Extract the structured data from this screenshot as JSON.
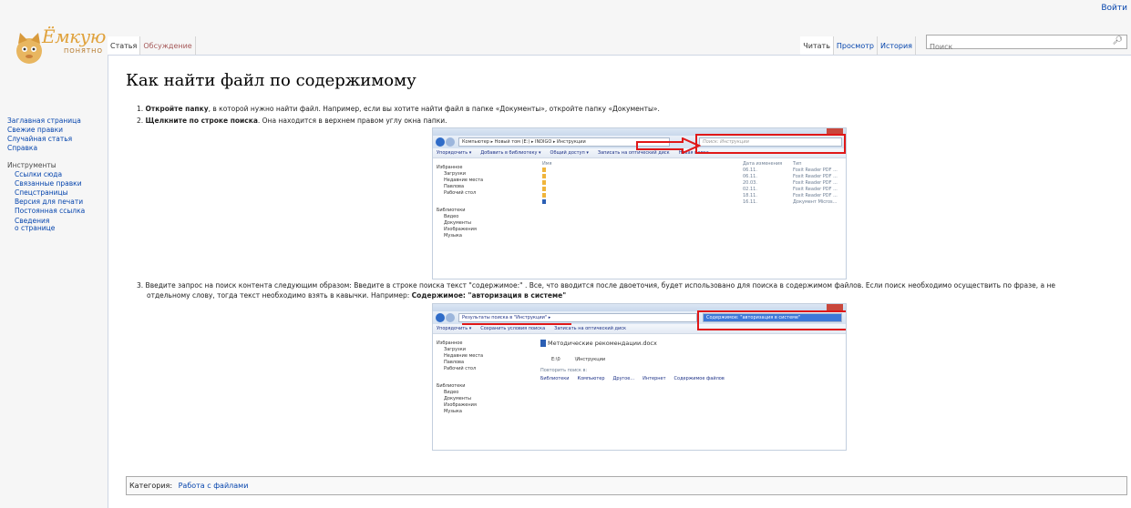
{
  "header": {
    "login": "Войти"
  },
  "logo": {
    "text": "Ёмкую",
    "sub": "ПОНЯТНО",
    "accent": "#e0a23c"
  },
  "tabs_left": [
    "Статья",
    "Обсуждение"
  ],
  "tabs_right": [
    "Читать",
    "Просмотр",
    "История"
  ],
  "search": {
    "placeholder": "Поиск"
  },
  "sidebar": {
    "nav": [
      "Заглавная страница",
      "Свежие правки",
      "Случайная статья",
      "Справка"
    ],
    "tools_heading": "Инструменты",
    "tools": [
      "Ссылки сюда",
      "Связанные правки",
      "Спецстраницы",
      "Версия для печати",
      "Постоянная ссылка",
      "Сведения",
      "о странице"
    ]
  },
  "article": {
    "title": "Как найти файл по содержимому",
    "step1": {
      "num": "1.",
      "bold": "Откройте папку",
      "text": ", в которой нужно найти файл. Например, если вы хотите найти файл в папке «Документы», откройте папку «Документы»."
    },
    "step2": {
      "num": "2.",
      "bold": "Щелкните по строке поиска",
      "text": ". Она находится в верхнем правом углу окна папки."
    },
    "step3": {
      "num": "3.",
      "line1": "Введите запрос на поиск контента следующим образом: Введите в строке поиска текст \"содержимое:\" . Все, что вводится после двоеточия, будет использовано для поиска в содержимом файлов. Если поиск необходимо осуществить по фразе, а не",
      "line2": "отдельному слову, тогда текст необходимо взять в кавычки. Например: ",
      "bold": "Содержимое: \"авторизация в системе\""
    }
  },
  "shot1": {
    "path": "Компьютер ▸ Новый том (E:) ▸ INDIGO ▸ Инструкции",
    "search": "Поиск: Инструкции",
    "tools": [
      "Упорядочить ▾",
      "Добавить в библиотеку ▾",
      "Общий доступ ▾",
      "Записать на оптический диск",
      "Новая папка"
    ],
    "nav": [
      "Избранное",
      "Загрузки",
      "Недавние места",
      "Павлова",
      "Рабочий стол",
      "Библиотеки",
      "Видео",
      "Документы",
      "Изображения",
      "Музыка"
    ],
    "columns": [
      "Имя",
      "Дата изменения",
      "Тип"
    ],
    "dates": [
      "06.11.",
      "06.11.",
      "20.03.",
      "02.11.",
      "18.11.",
      "16.11."
    ],
    "types": [
      "Foxit Reader PDF ...",
      "Foxit Reader PDF ...",
      "Foxit Reader PDF ...",
      "Foxit Reader PDF ...",
      "Foxit Reader PDF ...",
      "Документ Micros..."
    ]
  },
  "shot2": {
    "path": "Результаты поиска в \"Инструкции\" ▸",
    "search": "Содержимое: \"авторизация в системе\"",
    "tools": [
      "Упорядочить ▾",
      "Сохранить условия поиска",
      "Записать на оптический диск"
    ],
    "nav": [
      "Избранное",
      "Загрузки",
      "Недавние места",
      "Павлова",
      "Рабочий стол",
      "Библиотеки",
      "Видео",
      "Документы",
      "Изображения",
      "Музыка"
    ],
    "file": "Методические рекомендации.docx",
    "drive": "E:\\0",
    "folder": "\\Инструкции",
    "repeat": "Повторить поиск в:",
    "locations": [
      "Библиотеки",
      "Компьютер",
      "Другое...",
      "Интернет",
      "Содержимое файлов"
    ]
  },
  "category": {
    "label": "Категория:",
    "link": "Работа с файлами"
  }
}
